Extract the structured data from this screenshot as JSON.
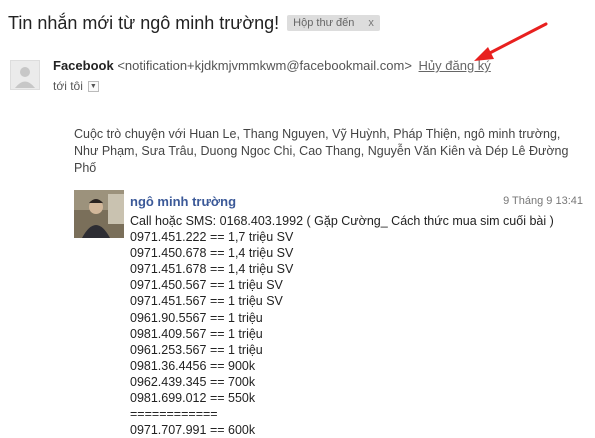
{
  "header": {
    "subject": "Tin nhắn mới từ ngô minh trường!",
    "label": "Hộp thư đến",
    "label_close": "x"
  },
  "sender": {
    "name": "Facebook",
    "email": "<notification+kjdkmjvmmkwm@facebookmail.com>",
    "unsubscribe": "Hủy đăng ký",
    "to": "tới tôi",
    "to_dropdown_icon": "▼"
  },
  "annotation": {
    "arrow_color": "#e8201f"
  },
  "conversation": {
    "participants": "Cuộc trò chuyện với Huan Le, Thang Nguyen, Vỹ Huỳnh, Pháp Thiện, ngô minh trường, Như Phạm, Sưa Trâu, Duong Ngoc Chi, Cao Thang, Nguyễn Văn Kiên và Dép Lê Đường Phố"
  },
  "message": {
    "author": "ngô minh trường",
    "date": "9 Tháng 9 13:41",
    "lines": [
      "Call hoặc SMS: 0168.403.1992 ( Gặp Cường_ Cách thức mua sim cuối bài )",
      "0971.451.222 == 1,7 triệu SV",
      "0971.450.678 == 1,4 triệu SV",
      "0971.451.678 == 1,4 triệu SV",
      "0971.450.567 == 1 triệu SV",
      "0971.451.567 == 1 triệu SV",
      "0961.90.5567 == 1 triệu",
      "0981.409.567 == 1 triệu",
      "0961.253.567 == 1 triệu",
      "0981.36.4456 == 900k",
      "0962.439.345 == 700k",
      "0981.699.012 == 550k",
      "============",
      "0971.707.991 == 600k"
    ]
  }
}
